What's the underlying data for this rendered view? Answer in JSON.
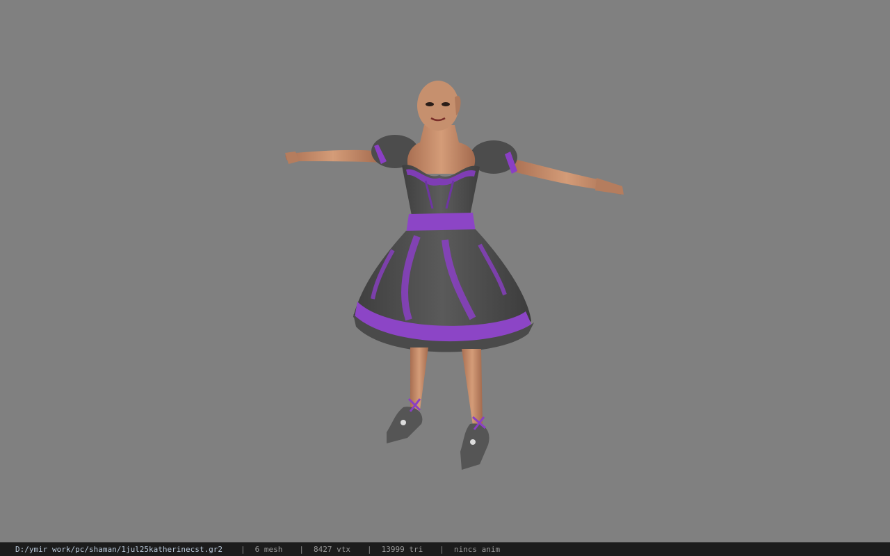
{
  "viewport": {
    "background": "#808080",
    "model_name": "female-character-in-purple-gray-dress"
  },
  "status_bar": {
    "file_path": "D:/ymir work/pc/shaman/1jul25katherinecst.gr2",
    "separator": "|",
    "mesh": "6 mesh",
    "vertices": "8427 vtx",
    "triangles": "13999 tri",
    "animation": "nincs anim"
  },
  "colors": {
    "status_bg": "#1c1c1c",
    "path_text": "#b8c7d8",
    "info_text": "#9a9a9a",
    "dress_gray": "#4b4b4b",
    "dress_purple": "#8a3fc4",
    "skin": "#c98d6a"
  }
}
